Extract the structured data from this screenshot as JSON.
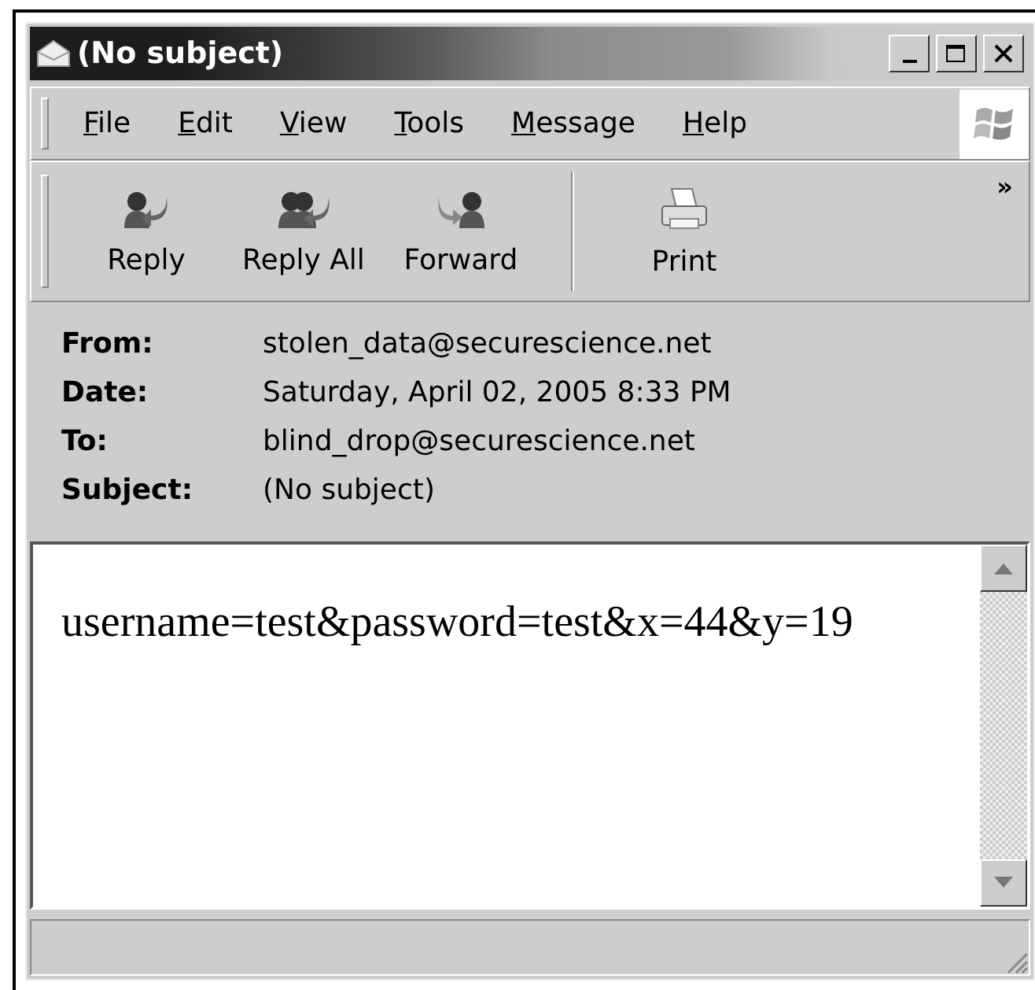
{
  "window": {
    "title": "(No subject)"
  },
  "menu": [
    "File",
    "Edit",
    "View",
    "Tools",
    "Message",
    "Help"
  ],
  "toolbar": [
    {
      "label": "Reply",
      "kind": "reply"
    },
    {
      "label": "Reply All",
      "kind": "reply-all"
    },
    {
      "label": "Forward",
      "kind": "forward"
    },
    {
      "label": "Print",
      "kind": "print"
    }
  ],
  "toolbar_more": "»",
  "headers": [
    {
      "label": "From:",
      "value": "stolen_data@securescience.net"
    },
    {
      "label": "Date:",
      "value": "Saturday, April 02, 2005 8:33 PM"
    },
    {
      "label": "To:",
      "value": "blind_drop@securescience.net"
    },
    {
      "label": "Subject:",
      "value": "(No subject)"
    }
  ],
  "body": "username=test&password=test&x=44&y=19"
}
